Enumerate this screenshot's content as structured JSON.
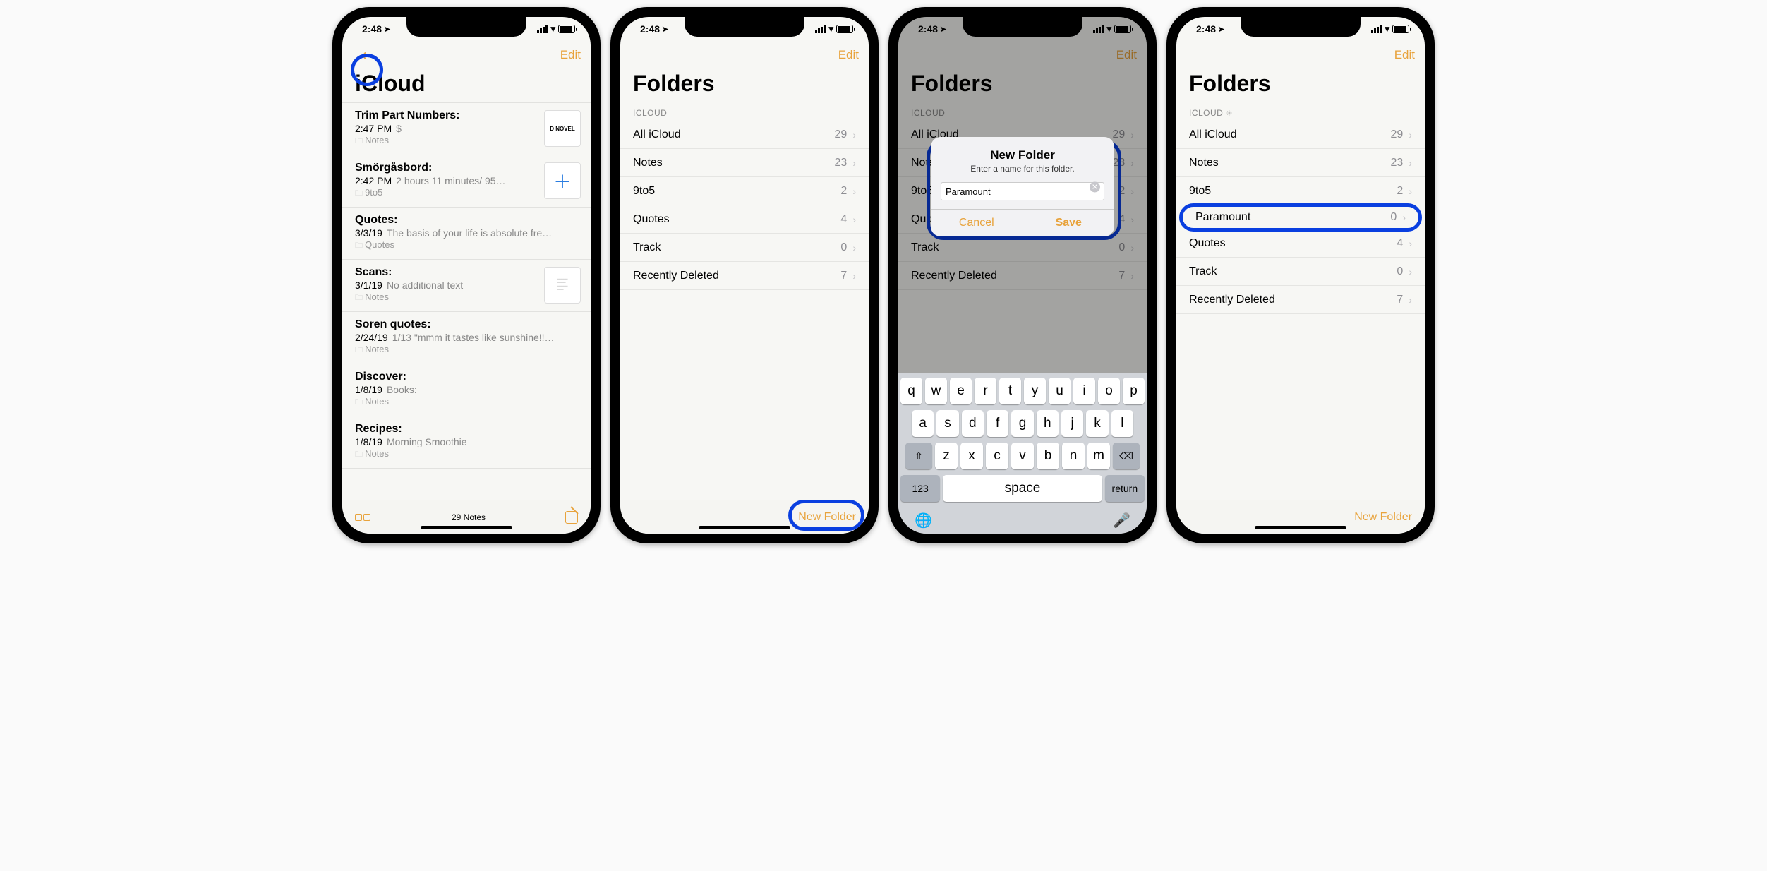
{
  "status": {
    "time": "2:48",
    "locArrow": "➤"
  },
  "nav": {
    "edit": "Edit"
  },
  "phone1": {
    "title": "iCloud",
    "notes": [
      {
        "title": "Trim Part Numbers:",
        "time": "2:47 PM",
        "preview": "$",
        "folder": "Notes",
        "thumb": "novel"
      },
      {
        "title": "Smörgåsbord:",
        "time": "2:42 PM",
        "preview": "2 hours 11 minutes/ 95…",
        "folder": "9to5",
        "thumb": "plus"
      },
      {
        "title": "Quotes:",
        "time": "3/3/19",
        "preview": "The basis of your life is absolute fre…",
        "folder": "Quotes"
      },
      {
        "title": "Scans:",
        "time": "3/1/19",
        "preview": "No additional text",
        "folder": "Notes",
        "thumb": "scan"
      },
      {
        "title": "Soren quotes:",
        "time": "2/24/19",
        "preview": "1/13 \"mmm it tastes like sunshine!!…",
        "folder": "Notes"
      },
      {
        "title": "Discover:",
        "time": "1/8/19",
        "preview": "Books:",
        "folder": "Notes"
      },
      {
        "title": "Recipes:",
        "time": "1/8/19",
        "preview": "Morning Smoothie",
        "folder": "Notes"
      }
    ],
    "toolbarCount": "29 Notes"
  },
  "phone2": {
    "title": "Folders",
    "section": "ICLOUD",
    "folders": [
      {
        "name": "All iCloud",
        "count": 29
      },
      {
        "name": "Notes",
        "count": 23
      },
      {
        "name": "9to5",
        "count": 2
      },
      {
        "name": "Quotes",
        "count": 4
      },
      {
        "name": "Track",
        "count": 0
      },
      {
        "name": "Recently Deleted",
        "count": 7
      }
    ],
    "newFolder": "New Folder"
  },
  "phone3": {
    "title": "Folders",
    "section": "ICLOUD",
    "alert": {
      "title": "New Folder",
      "message": "Enter a name for this folder.",
      "value": "Paramount",
      "cancel": "Cancel",
      "save": "Save"
    },
    "keyboard": {
      "row1": [
        "q",
        "w",
        "e",
        "r",
        "t",
        "y",
        "u",
        "i",
        "o",
        "p"
      ],
      "row2": [
        "a",
        "s",
        "d",
        "f",
        "g",
        "h",
        "j",
        "k",
        "l"
      ],
      "row3": [
        "⇧",
        "z",
        "x",
        "c",
        "v",
        "b",
        "n",
        "m",
        "⌫"
      ],
      "row4": {
        "num": "123",
        "space": "space",
        "ret": "return"
      }
    },
    "foldersDim": [
      {
        "name": "All iCloud",
        "count": 29
      },
      {
        "name": "Notes",
        "count": 23
      },
      {
        "name": "9to5",
        "count": 2
      },
      {
        "name": "Quotes",
        "count": 4
      },
      {
        "name": "Track",
        "count": 0
      },
      {
        "name": "Recently Deleted",
        "count": 7
      }
    ]
  },
  "phone4": {
    "title": "Folders",
    "section": "ICLOUD",
    "folders": [
      {
        "name": "All iCloud",
        "count": 29
      },
      {
        "name": "Notes",
        "count": 23
      },
      {
        "name": "9to5",
        "count": 2
      },
      {
        "name": "Paramount",
        "count": 0,
        "highlight": true
      },
      {
        "name": "Quotes",
        "count": 4
      },
      {
        "name": "Track",
        "count": 0
      },
      {
        "name": "Recently Deleted",
        "count": 7
      }
    ],
    "newFolder": "New Folder"
  }
}
